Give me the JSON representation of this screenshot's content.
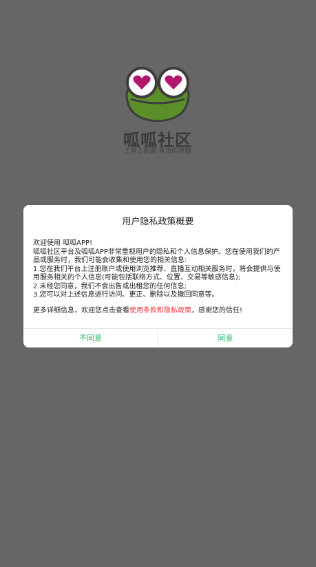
{
  "splash": {
    "app_name": "呱呱社区",
    "slogan": "上座上圆圆 曾出的范精",
    "logo_icon": "frog-heart-eyes-icon"
  },
  "dialog": {
    "title": "用户隐私政策概要",
    "greeting": "欢迎使用 呱呱APP!",
    "intro": "呱呱社区平台及呱呱APP非常重视用户的隐私和个人信息保护。您在使用我们的产品或服务时，我们可能会收集和使用您的相关信息:",
    "item1": "1.您在我们平台上注册账户或使用浏览推荐、直播互动相关服务时，将会提供与使用服务相关的个人信息(可能包括联络方式、位置、交易等敏感信息);",
    "item2": "2.未经您同意，我们不会出售或出租您的任何信息;",
    "item3": "3.您可以对上述信息进行访问、更正、删除以及撤回同意等。",
    "more_prefix": "更多详细信息，欢迎您点击查看",
    "policy_link": "使用条款和隐私政策",
    "more_suffix": "，感谢您的信任!",
    "disagree_label": "不同意",
    "agree_label": "同意"
  },
  "colors": {
    "overlay": "#666666",
    "accent_green": "#28b36a",
    "link_red": "#e8383d",
    "frog_green": "#5a8f29"
  }
}
